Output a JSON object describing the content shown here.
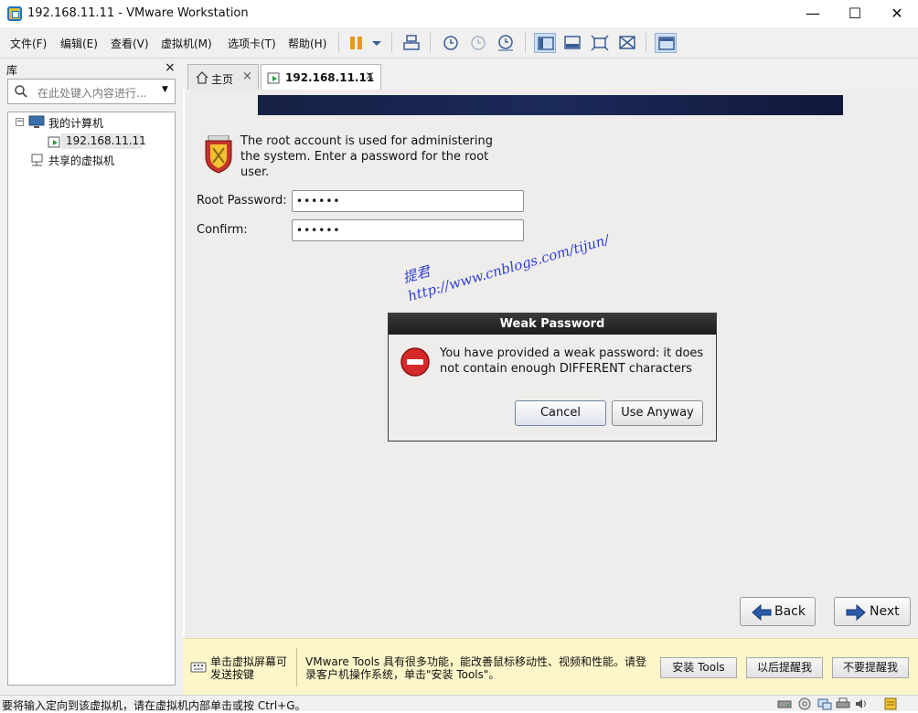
{
  "window": {
    "title": "192.168.11.11 - VMware Workstation",
    "minimize": "—",
    "maximize": "☐",
    "close": "✕"
  },
  "menu": {
    "items": [
      "文件(F)",
      "编辑(E)",
      "查看(V)",
      "虚拟机(M)",
      "选项卡(T)",
      "帮助(H)"
    ]
  },
  "library": {
    "title": "库",
    "close": "×",
    "search_placeholder": "在此处键入内容进行...",
    "tree": {
      "my_computer": "我的计算机",
      "vm": "192.168.11.11",
      "shared": "共享的虚拟机"
    }
  },
  "tabs": {
    "home": "主页",
    "vm": "192.168.11.11",
    "close": "×"
  },
  "installer": {
    "intro": "The root account is used for administering the system.  Enter a password for the root user.",
    "root_password_label": "Root Password:",
    "root_password_value": "••••••",
    "confirm_label": "Confirm:",
    "confirm_value": "••••••",
    "back": "Back",
    "next": "Next"
  },
  "watermark": {
    "line1": "提君",
    "line2": "http://www.cnblogs.com/tijun/"
  },
  "dialog": {
    "title": "Weak Password",
    "message": "You have provided a weak password: it does not contain enough DIFFERENT characters",
    "cancel": "Cancel",
    "use_anyway": "Use Anyway"
  },
  "notification": {
    "left_text": "单击虚拟屏幕可发送按键",
    "message": "VMware Tools 具有很多功能，能改善鼠标移动性、视频和性能。请登录客户机操作系统，单击\"安装 Tools\"。",
    "install_tools": "安装 Tools",
    "remind_later": "以后提醒我",
    "never_remind": "不要提醒我"
  },
  "status": {
    "text": "要将输入定向到该虚拟机，请在虚拟机内部单击或按 Ctrl+G。"
  },
  "colors": {
    "accent": "#1f74c0",
    "pause": "#e89a16",
    "dialog_header": "#2a2a2a",
    "notification_bg": "#fdf6c9",
    "arrow_blue": "#2b5aa8"
  }
}
